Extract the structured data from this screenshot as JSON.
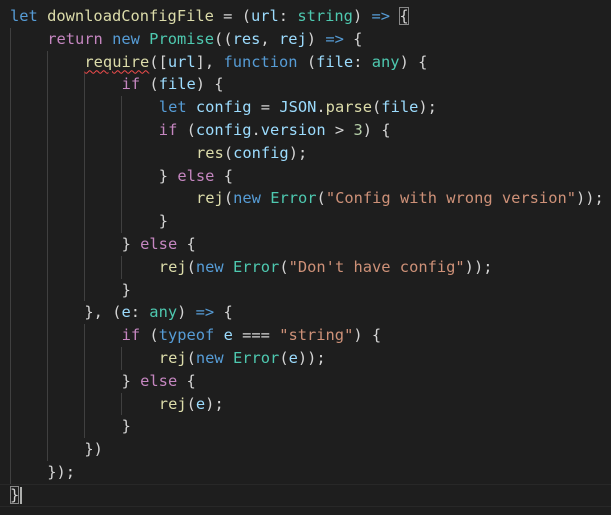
{
  "editor": {
    "language": "typescript",
    "lines": [
      [
        [
          "k",
          "let"
        ],
        [
          "p",
          " "
        ],
        [
          "f",
          "downloadConfigFile"
        ],
        [
          "p",
          " = ("
        ],
        [
          "v",
          "url"
        ],
        [
          "p",
          ": "
        ],
        [
          "t",
          "string"
        ],
        [
          "p",
          ") "
        ],
        [
          "k",
          "=>"
        ],
        [
          "p",
          " "
        ],
        [
          "pb",
          "{"
        ]
      ],
      [
        [
          "kc",
          "return"
        ],
        [
          "p",
          " "
        ],
        [
          "k",
          "new"
        ],
        [
          "p",
          " "
        ],
        [
          "t",
          "Promise"
        ],
        [
          "p",
          "(("
        ],
        [
          "v",
          "res"
        ],
        [
          "p",
          ", "
        ],
        [
          "v",
          "rej"
        ],
        [
          "p",
          ") "
        ],
        [
          "k",
          "=>"
        ],
        [
          "p",
          " {"
        ]
      ],
      [
        [
          "fs",
          "require"
        ],
        [
          "p",
          "(["
        ],
        [
          "v",
          "url"
        ],
        [
          "p",
          "], "
        ],
        [
          "k",
          "function"
        ],
        [
          "p",
          " ("
        ],
        [
          "v",
          "file"
        ],
        [
          "p",
          ": "
        ],
        [
          "t",
          "any"
        ],
        [
          "p",
          ") {"
        ]
      ],
      [
        [
          "kc",
          "if"
        ],
        [
          "p",
          " ("
        ],
        [
          "v",
          "file"
        ],
        [
          "p",
          ") {"
        ]
      ],
      [
        [
          "k",
          "let"
        ],
        [
          "p",
          " "
        ],
        [
          "v",
          "config"
        ],
        [
          "p",
          " = "
        ],
        [
          "v",
          "JSON"
        ],
        [
          "p",
          "."
        ],
        [
          "f",
          "parse"
        ],
        [
          "p",
          "("
        ],
        [
          "v",
          "file"
        ],
        [
          "p",
          ");"
        ]
      ],
      [
        [
          "kc",
          "if"
        ],
        [
          "p",
          " ("
        ],
        [
          "v",
          "config"
        ],
        [
          "p",
          "."
        ],
        [
          "v",
          "version"
        ],
        [
          "p",
          " > "
        ],
        [
          "n",
          "3"
        ],
        [
          "p",
          ") {"
        ]
      ],
      [
        [
          "f",
          "res"
        ],
        [
          "p",
          "("
        ],
        [
          "v",
          "config"
        ],
        [
          "p",
          ");"
        ]
      ],
      [
        [
          "p",
          "} "
        ],
        [
          "kc",
          "else"
        ],
        [
          "p",
          " {"
        ]
      ],
      [
        [
          "f",
          "rej"
        ],
        [
          "p",
          "("
        ],
        [
          "k",
          "new"
        ],
        [
          "p",
          " "
        ],
        [
          "t",
          "Error"
        ],
        [
          "p",
          "("
        ],
        [
          "s",
          "\"Config with wrong version\""
        ],
        [
          "p",
          "));"
        ]
      ],
      [
        [
          "p",
          "}"
        ]
      ],
      [
        [
          "p",
          "} "
        ],
        [
          "kc",
          "else"
        ],
        [
          "p",
          " {"
        ]
      ],
      [
        [
          "f",
          "rej"
        ],
        [
          "p",
          "("
        ],
        [
          "k",
          "new"
        ],
        [
          "p",
          " "
        ],
        [
          "t",
          "Error"
        ],
        [
          "p",
          "("
        ],
        [
          "s",
          "\"Don't have config\""
        ],
        [
          "p",
          "));"
        ]
      ],
      [
        [
          "p",
          "}"
        ]
      ],
      [
        [
          "p",
          "}, ("
        ],
        [
          "v",
          "e"
        ],
        [
          "p",
          ": "
        ],
        [
          "t",
          "any"
        ],
        [
          "p",
          ") "
        ],
        [
          "k",
          "=>"
        ],
        [
          "p",
          " {"
        ]
      ],
      [
        [
          "kc",
          "if"
        ],
        [
          "p",
          " ("
        ],
        [
          "k",
          "typeof"
        ],
        [
          "p",
          " "
        ],
        [
          "v",
          "e"
        ],
        [
          "p",
          " === "
        ],
        [
          "s",
          "\"string\""
        ],
        [
          "p",
          ") {"
        ]
      ],
      [
        [
          "f",
          "rej"
        ],
        [
          "p",
          "("
        ],
        [
          "k",
          "new"
        ],
        [
          "p",
          " "
        ],
        [
          "t",
          "Error"
        ],
        [
          "p",
          "("
        ],
        [
          "v",
          "e"
        ],
        [
          "p",
          "));"
        ]
      ],
      [
        [
          "p",
          "} "
        ],
        [
          "kc",
          "else"
        ],
        [
          "p",
          " {"
        ]
      ],
      [
        [
          "f",
          "rej"
        ],
        [
          "p",
          "("
        ],
        [
          "v",
          "e"
        ],
        [
          "p",
          ");"
        ]
      ],
      [
        [
          "p",
          "}"
        ]
      ],
      [
        [
          "p",
          "})"
        ]
      ],
      [
        [
          "p",
          "});"
        ]
      ],
      [
        [
          "pb",
          "}"
        ]
      ]
    ]
  }
}
